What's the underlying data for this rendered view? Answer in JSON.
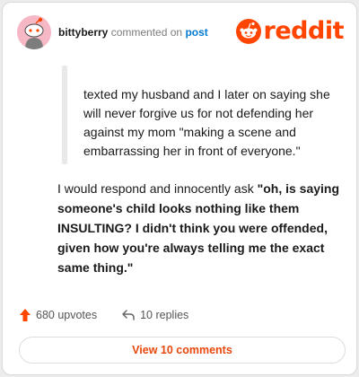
{
  "header": {
    "username": "bittyberry",
    "action_text": "commented on",
    "target_link": "post",
    "brand_name": "reddit",
    "brand_color": "#ff4500",
    "avatar_color": "#f7b8c6"
  },
  "comment": {
    "quote": "texted my husband and I later on saying she will never forgive us for not defending her against my mom \"making a scene and embarrassing her in front of everyone.\"",
    "body_intro": "I would respond and innocently ask ",
    "body_bold": "\"oh, is saying someone's child looks nothing like them INSULTING? I didn't think you were offended, given how you're always telling me the exact same thing.\""
  },
  "actions": {
    "upvotes_label": "680 upvotes",
    "replies_label": "10 replies",
    "upvote_icon": "upvote-arrow-icon",
    "reply_icon": "reply-arrow-icon"
  },
  "footer": {
    "view_comments_label": "View 10 comments",
    "accent_color": "#e8480d"
  }
}
